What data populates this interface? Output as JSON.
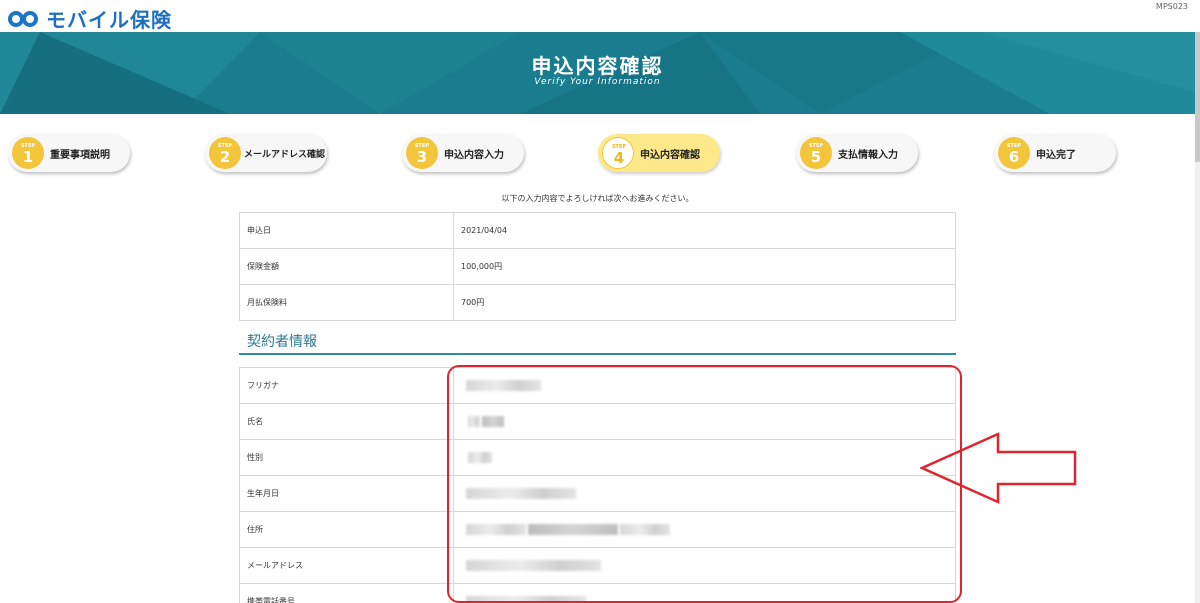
{
  "header": {
    "logo_text": "モバイル保険",
    "screen_id": "MPS023"
  },
  "hero": {
    "title": "申込内容確認",
    "subtitle": "Verify Your Information"
  },
  "steps": [
    {
      "label_top": "STEP",
      "number": "1",
      "label": "重要事項説明",
      "active": false
    },
    {
      "label_top": "STEP",
      "number": "2",
      "label": "メールアドレス確認",
      "active": false
    },
    {
      "label_top": "STEP",
      "number": "3",
      "label": "申込内容入力",
      "active": false
    },
    {
      "label_top": "STEP",
      "number": "4",
      "label": "申込内容確認",
      "active": true
    },
    {
      "label_top": "STEP",
      "number": "5",
      "label": "支払情報入力",
      "active": false
    },
    {
      "label_top": "STEP",
      "number": "6",
      "label": "申込完了",
      "active": false
    }
  ],
  "instruction": "以下の入力内容でよろしければ次へお進みください。",
  "summary": [
    {
      "key": "申込日",
      "value": "2021/04/04"
    },
    {
      "key": "保険金額",
      "value": "100,000円"
    },
    {
      "key": "月払保険料",
      "value": "700円"
    }
  ],
  "contractor_section": {
    "title": "契約者情報",
    "rows": [
      {
        "key": "フリガナ",
        "value": ""
      },
      {
        "key": "氏名",
        "value": ""
      },
      {
        "key": "性別",
        "value": ""
      },
      {
        "key": "生年月日",
        "value": ""
      },
      {
        "key": "住所",
        "value": ""
      },
      {
        "key": "メールアドレス",
        "value": ""
      },
      {
        "key": "携帯電話番号",
        "value": ""
      }
    ]
  },
  "colors": {
    "brand": "#1e6fc0",
    "hero": "#1a7d8f",
    "step_badge": "#f2c53a",
    "active_step": "#fde98a",
    "annotation": "#e0242f"
  }
}
